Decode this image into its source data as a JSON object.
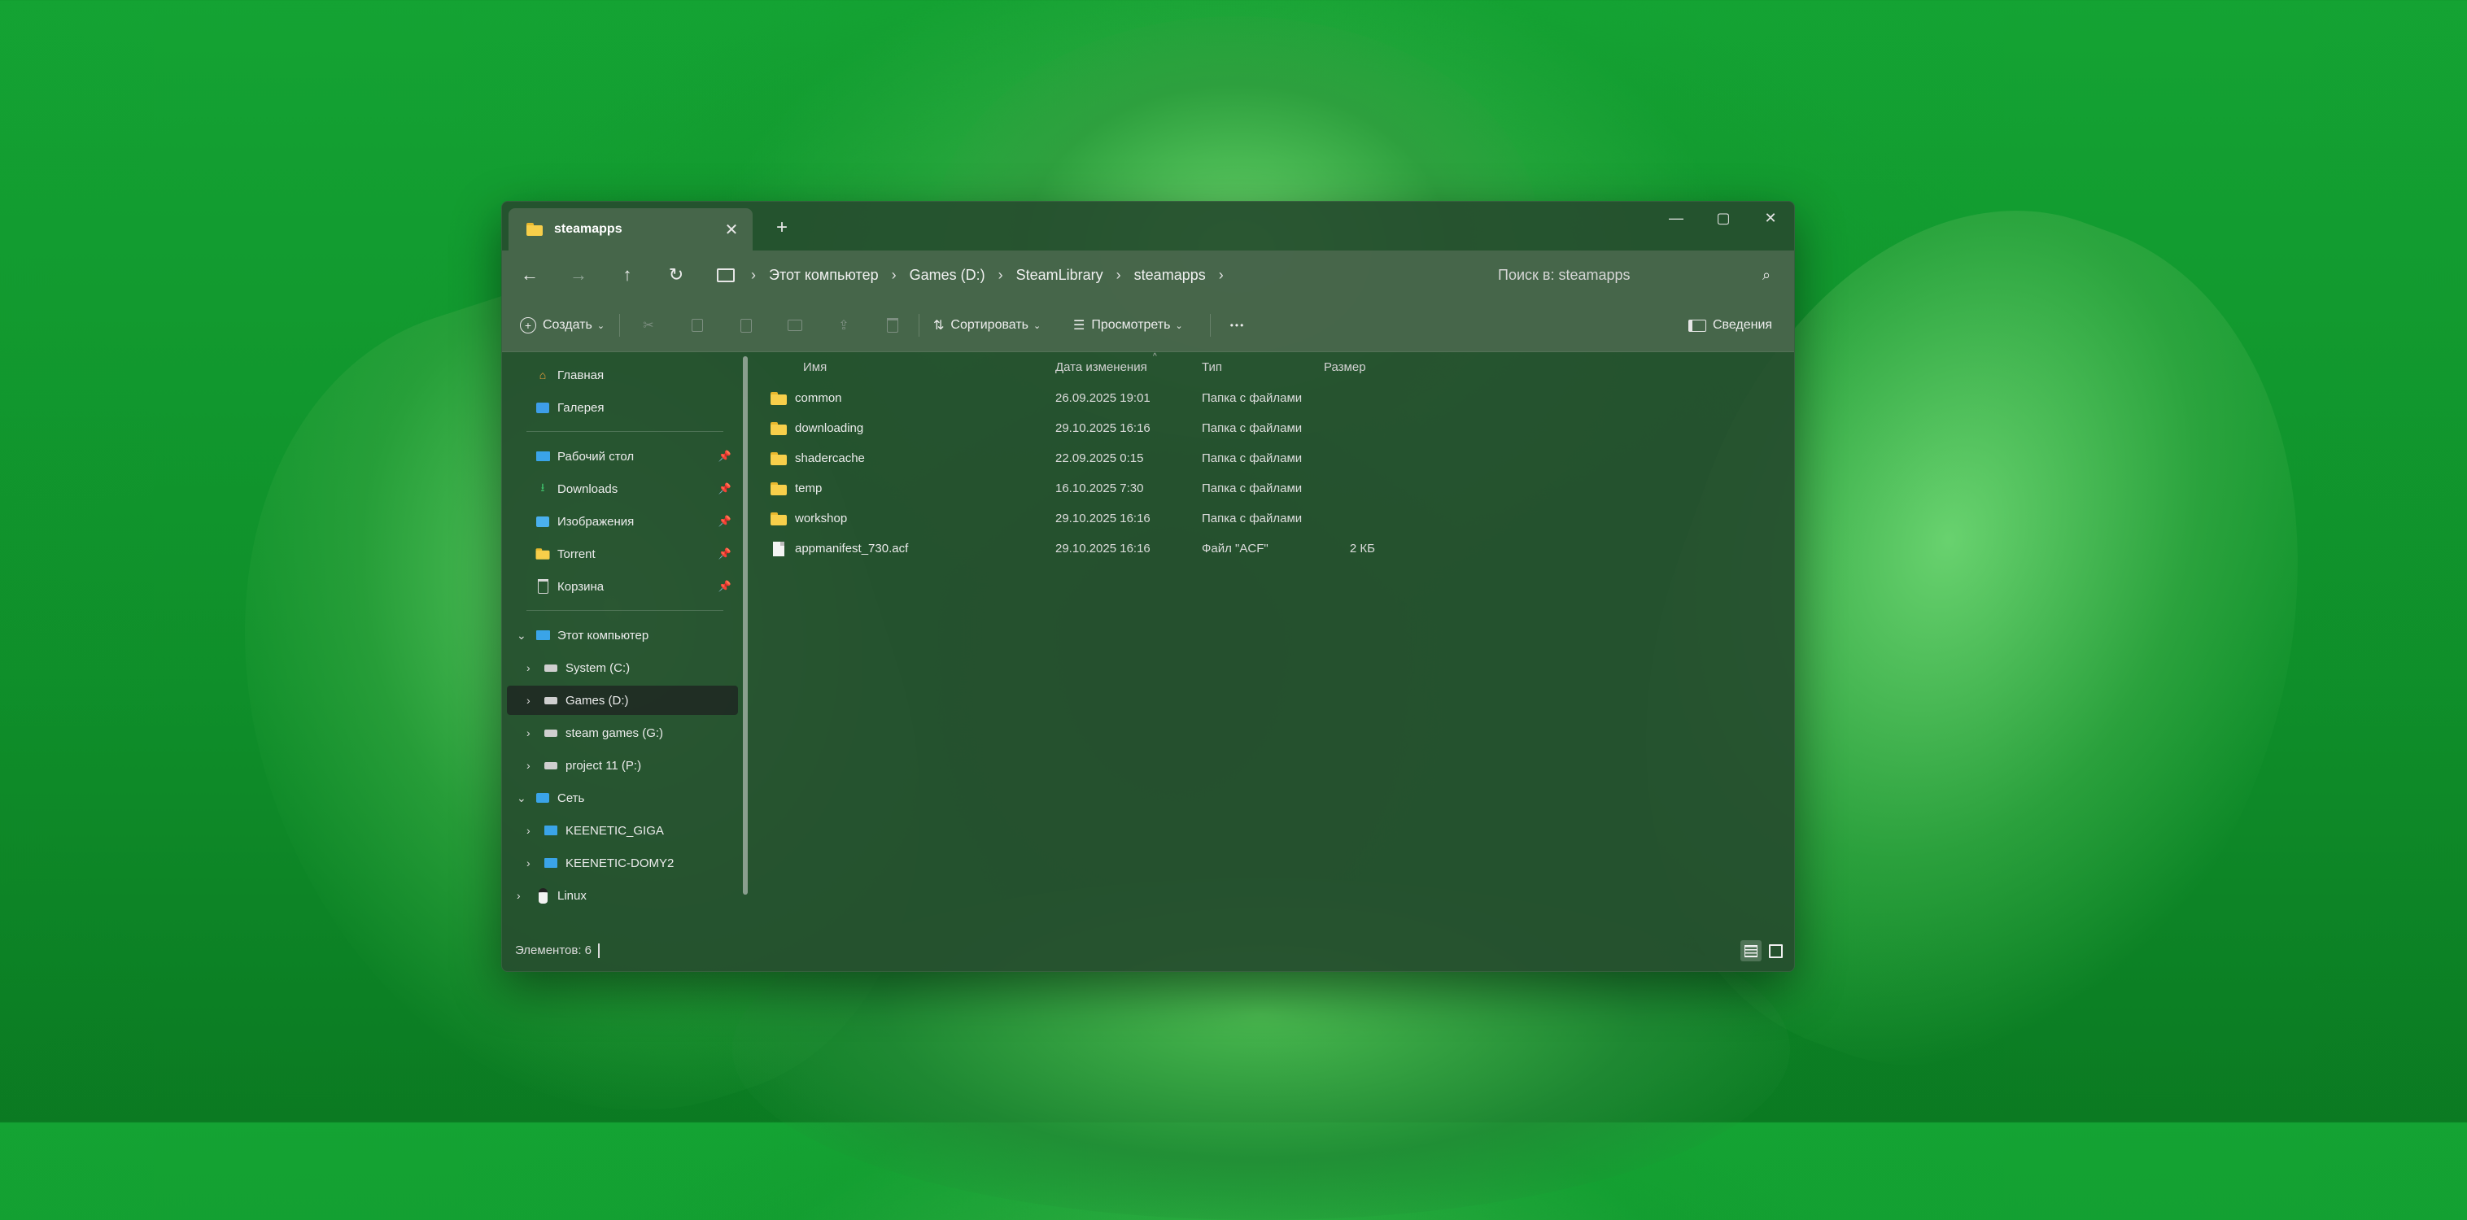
{
  "window": {
    "tab_title": "steamapps",
    "tab_close_glyph": "✕",
    "tab_add_glyph": "+",
    "minimize_glyph": "—",
    "maximize_glyph": "▢",
    "close_glyph": "✕"
  },
  "nav": {
    "back_glyph": "←",
    "forward_glyph": "→",
    "up_glyph": "↑",
    "refresh_glyph": "↻"
  },
  "breadcrumb": {
    "items": [
      "Этот компьютер",
      "Games (D:)",
      "SteamLibrary",
      "steamapps"
    ],
    "separator": "›"
  },
  "search": {
    "placeholder": "Поиск в: steamapps",
    "icon_glyph": "⌕"
  },
  "toolbar": {
    "create_label": "Создать",
    "sort_label": "Сортировать",
    "view_label": "Просмотреть",
    "more_glyph": "•••",
    "details_label": "Сведения",
    "caret": "⌄"
  },
  "sidebar": {
    "home": "Главная",
    "gallery": "Галерея",
    "pinned": [
      "Рабочий стол",
      "Downloads",
      "Изображения",
      "Torrent",
      "Корзина"
    ],
    "this_pc": "Этот компьютер",
    "drives": [
      "System (C:)",
      "Games (D:)",
      "steam games (G:)",
      "project 11 (P:)"
    ],
    "network": "Сеть",
    "network_items": [
      "KEENETIC_GIGA",
      "KEENETIC-DOMY2"
    ],
    "linux": "Linux",
    "pin_glyph": "📌",
    "chevron_right": "›",
    "chevron_down": "⌄"
  },
  "columns": {
    "name": "Имя",
    "date": "Дата изменения",
    "type": "Тип",
    "size": "Размер",
    "sort_caret": "^"
  },
  "files": [
    {
      "name": "common",
      "date": "26.09.2025 19:01",
      "type": "Папка с файлами",
      "size": ""
    },
    {
      "name": "downloading",
      "date": "29.10.2025 16:16",
      "type": "Папка с файлами",
      "size": ""
    },
    {
      "name": "shadercache",
      "date": "22.09.2025 0:15",
      "type": "Папка с файлами",
      "size": ""
    },
    {
      "name": "temp",
      "date": "16.10.2025 7:30",
      "type": "Папка с файлами",
      "size": ""
    },
    {
      "name": "workshop",
      "date": "29.10.2025 16:16",
      "type": "Папка с файлами",
      "size": ""
    },
    {
      "name": "appmanifest_730.acf",
      "date": "29.10.2025 16:16",
      "type": "Файл \"ACF\"",
      "size": "2 КБ"
    }
  ],
  "status": {
    "count_text": "Элементов: 6"
  },
  "colors": {
    "window_bg": "#264e2e",
    "accent": "#1f8a33",
    "folder": "#f7cf4a"
  }
}
